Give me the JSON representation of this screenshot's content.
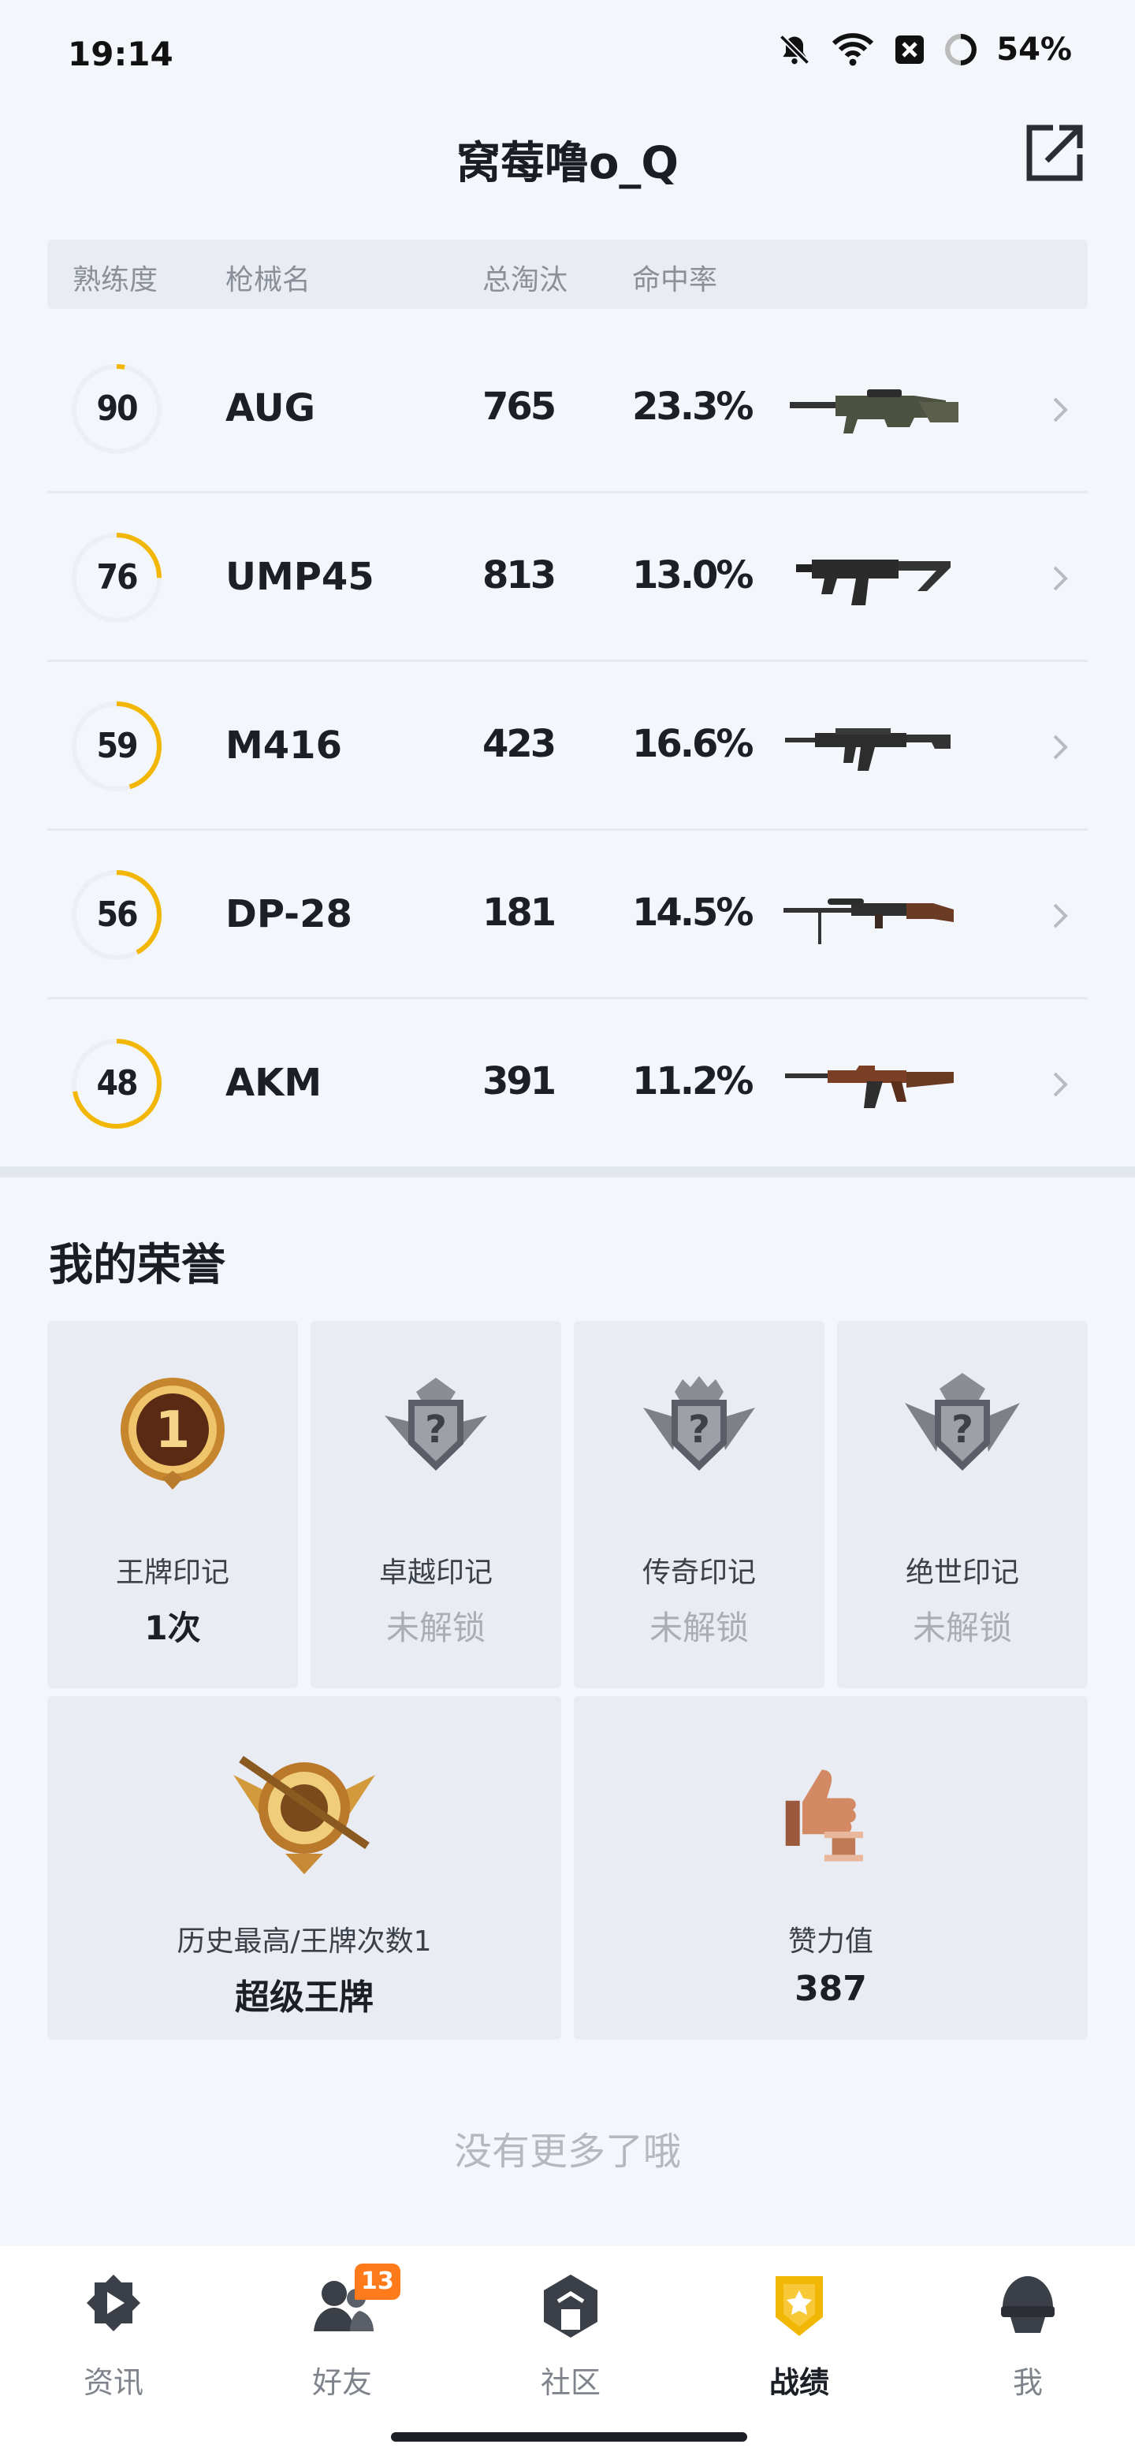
{
  "status": {
    "time": "19:14",
    "battery": "54%"
  },
  "header": {
    "title": "窝莓噜o_Q"
  },
  "table": {
    "headers": {
      "mastery": "熟练度",
      "weapon": "枪械名",
      "kills": "总淘汰",
      "accuracy": "命中率"
    },
    "rows": [
      {
        "mastery": "90",
        "mastery_pct": 0.03,
        "name": "AUG",
        "kills": "765",
        "accuracy": "23.3%",
        "gun_icon": "aug-rifle-icon"
      },
      {
        "mastery": "76",
        "mastery_pct": 0.25,
        "name": "UMP45",
        "kills": "813",
        "accuracy": "13.0%",
        "gun_icon": "smg-icon"
      },
      {
        "mastery": "59",
        "mastery_pct": 0.45,
        "name": "M416",
        "kills": "423",
        "accuracy": "16.6%",
        "gun_icon": "m416-rifle-icon"
      },
      {
        "mastery": "56",
        "mastery_pct": 0.42,
        "name": "DP-28",
        "kills": "181",
        "accuracy": "14.5%",
        "gun_icon": "lmg-icon"
      },
      {
        "mastery": "48",
        "mastery_pct": 0.72,
        "name": "AKM",
        "kills": "391",
        "accuracy": "11.2%",
        "gun_icon": "akm-rifle-icon"
      }
    ]
  },
  "honor": {
    "title": "我的荣誉",
    "badges": [
      {
        "label": "王牌印记",
        "value": "1次",
        "locked": false
      },
      {
        "label": "卓越印记",
        "value": "未解锁",
        "locked": true
      },
      {
        "label": "传奇印记",
        "value": "未解锁",
        "locked": true
      },
      {
        "label": "绝世印记",
        "value": "未解锁",
        "locked": true
      }
    ],
    "highest": {
      "label": "历史最高/王牌次数1",
      "value": "超级王牌"
    },
    "likes": {
      "label": "赞力值",
      "value": "387"
    }
  },
  "footer": {
    "no_more": "没有更多了哦"
  },
  "tabs": [
    {
      "label": "资讯",
      "icon": "news-icon"
    },
    {
      "label": "好友",
      "icon": "friends-icon",
      "badge": "13"
    },
    {
      "label": "社区",
      "icon": "community-icon"
    },
    {
      "label": "战绩",
      "icon": "record-icon",
      "active": true
    },
    {
      "label": "我",
      "icon": "profile-helmet-icon"
    }
  ],
  "colors": {
    "accent": "#f2b705",
    "ring_track": "#eceff3",
    "badge": "#ff7a1a"
  }
}
